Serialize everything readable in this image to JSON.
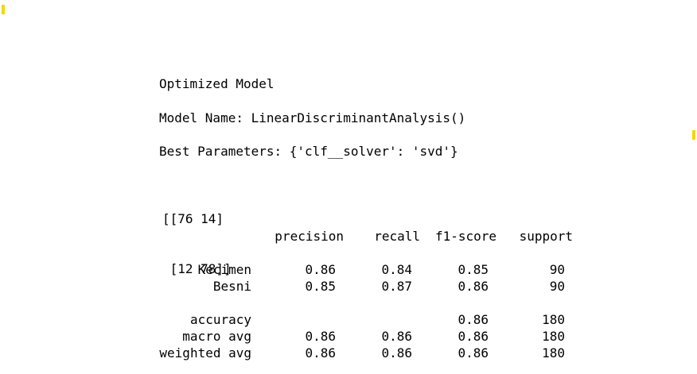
{
  "output": {
    "heading": "Optimized Model",
    "model_name_line": "Model Name: LinearDiscriminantAnalysis()",
    "best_params_line": "Best Parameters: {'clf__solver': 'svd'}",
    "confusion_matrix": [
      "[[76 14]",
      " [12 78]]"
    ]
  },
  "report": {
    "columns": [
      "precision",
      "recall",
      "f1-score",
      "support"
    ],
    "classes": [
      {
        "label": "Kecimen",
        "precision": "0.86",
        "recall": "0.84",
        "f1": "0.85",
        "support": "90"
      },
      {
        "label": "Besni",
        "precision": "0.85",
        "recall": "0.87",
        "f1": "0.86",
        "support": "90"
      }
    ],
    "summary": [
      {
        "label": "accuracy",
        "precision": "",
        "recall": "",
        "f1": "0.86",
        "support": "180"
      },
      {
        "label": "macro avg",
        "precision": "0.86",
        "recall": "0.86",
        "f1": "0.86",
        "support": "180"
      },
      {
        "label": "weighted avg",
        "precision": "0.86",
        "recall": "0.86",
        "f1": "0.86",
        "support": "180"
      }
    ]
  },
  "colors": {
    "marker": "#f2d800",
    "text": "#000000",
    "background": "#ffffff"
  }
}
